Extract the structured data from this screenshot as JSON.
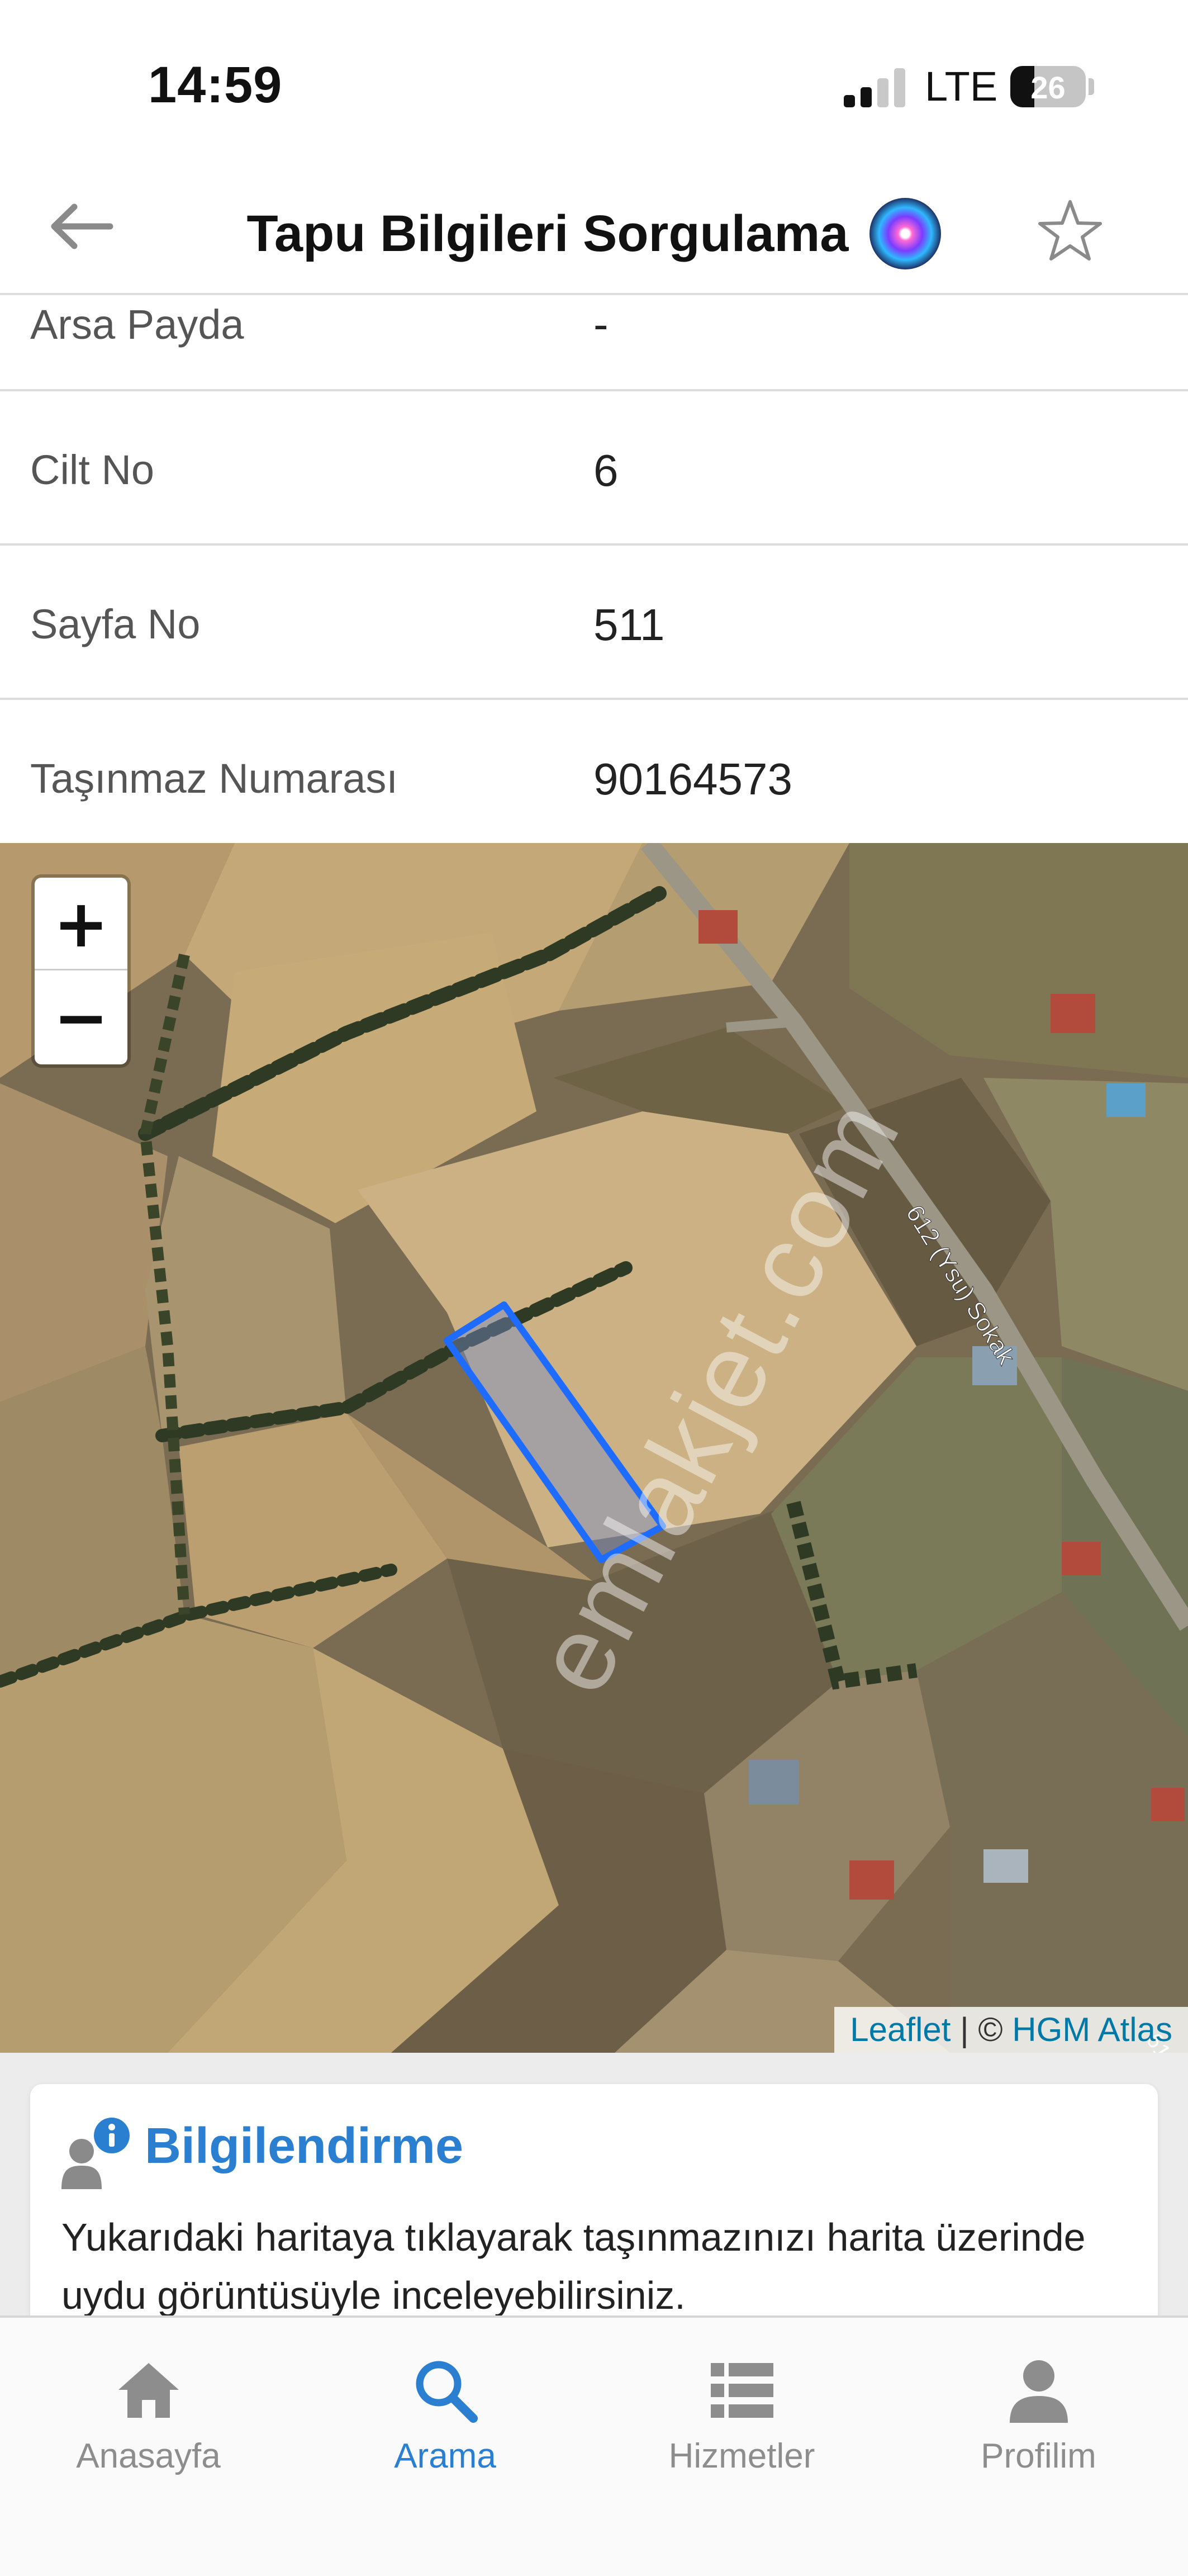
{
  "status_bar": {
    "time": "14:59",
    "network": "LTE",
    "battery": "26"
  },
  "header": {
    "title": "Tapu Bilgileri Sorgulama"
  },
  "details": [
    {
      "label": "Arsa Payda",
      "value": "-"
    },
    {
      "label": "Cilt No",
      "value": "6"
    },
    {
      "label": "Sayfa No",
      "value": "511"
    },
    {
      "label": "Taşınmaz Numarası",
      "value": "90164573"
    }
  ],
  "map": {
    "zoom_in": "+",
    "zoom_out": "−",
    "street_label": "612 (Ysu) Sokak",
    "street_label_edge": "61",
    "watermark": "emlakjet.com",
    "attribution": {
      "leaflet": "Leaflet",
      "separator": " | © ",
      "provider": "HGM Atlas"
    },
    "parcel_color": "#1e6bff"
  },
  "info_card": {
    "title": "Bilgilendirme",
    "text": "Yukarıdaki haritaya tıklayarak taşınmazınızı harita üzerinde uydu görüntüsüyle inceleyebilirsiniz.",
    "accent": "#2a7fd1"
  },
  "tabs": [
    {
      "label": "Anasayfa",
      "icon": "home-icon",
      "active": false
    },
    {
      "label": "Arama",
      "icon": "search-icon",
      "active": true
    },
    {
      "label": "Hizmetler",
      "icon": "list-icon",
      "active": false
    },
    {
      "label": "Profilim",
      "icon": "person-icon",
      "active": false
    }
  ]
}
